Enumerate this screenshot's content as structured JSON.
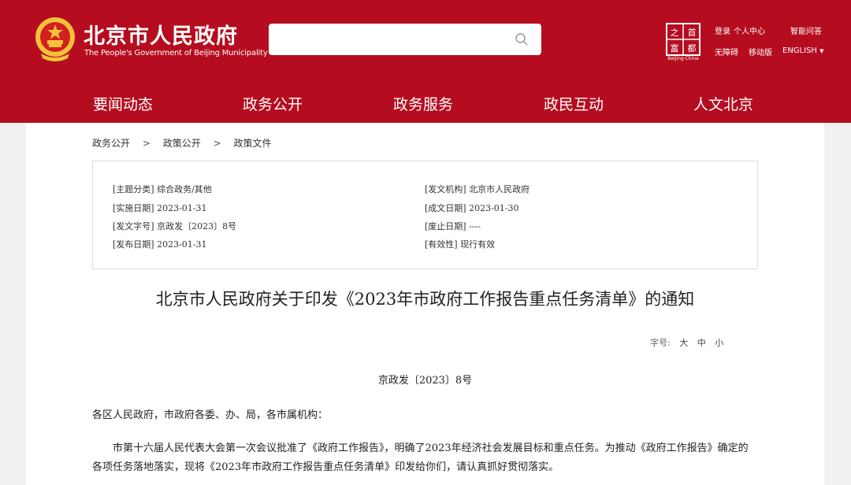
{
  "header": {
    "logo_cn": "北京市人民政府",
    "logo_en": "The People's Government of Beijing Municipality",
    "search": {
      "placeholder": "",
      "icon": "search-icon"
    },
    "badge_caption": "Beijing·China",
    "links": {
      "login": "登录",
      "personal_center": "个人中心",
      "smart_qa": "智能问答",
      "accessibility": "无障碍",
      "mobile": "移动版",
      "language": "ENGLISH",
      "language_arrow": "▼"
    },
    "nav": [
      "要闻动态",
      "政务公开",
      "政务服务",
      "政民互动",
      "人文北京"
    ]
  },
  "breadcrumb": {
    "items": [
      "政务公开",
      "政策公开",
      "政策文件"
    ],
    "separator": ">"
  },
  "meta": {
    "topic": "[主题分类] 综合政务/其他",
    "issuer": "[发文机构] 北京市人民政府",
    "effective_date": "[实施日期] 2023-01-31",
    "written_date": "[成文日期] 2023-01-30",
    "doc_number": "[发文字号] 京政发〔2023〕8号",
    "abolished_date": "[废止日期] ----",
    "published_date": "[发布日期] 2023-01-31",
    "validity": "[有效性] 现行有效"
  },
  "document": {
    "title": "北京市人民政府关于印发《2023年市政府工作报告重点任务清单》的通知",
    "font_size_label": "字号:",
    "font_size_options": [
      "大",
      "中",
      "小"
    ],
    "number": "京政发〔2023〕8号",
    "addressee": "各区人民政府，市政府各委、办、局，各市属机构：",
    "paragraph": "市第十六届人民代表大会第一次会议批准了《政府工作报告》，明确了2023年经济社会发展目标和重点任务。为推动《政府工作报告》确定的各项任务落地落实，现将《2023年市政府工作报告重点任务清单》印发给你们，请认真抓好贯彻落实。"
  },
  "colors": {
    "brand_red": "#b50d1f",
    "emblem_gold": "#f3c23a"
  }
}
